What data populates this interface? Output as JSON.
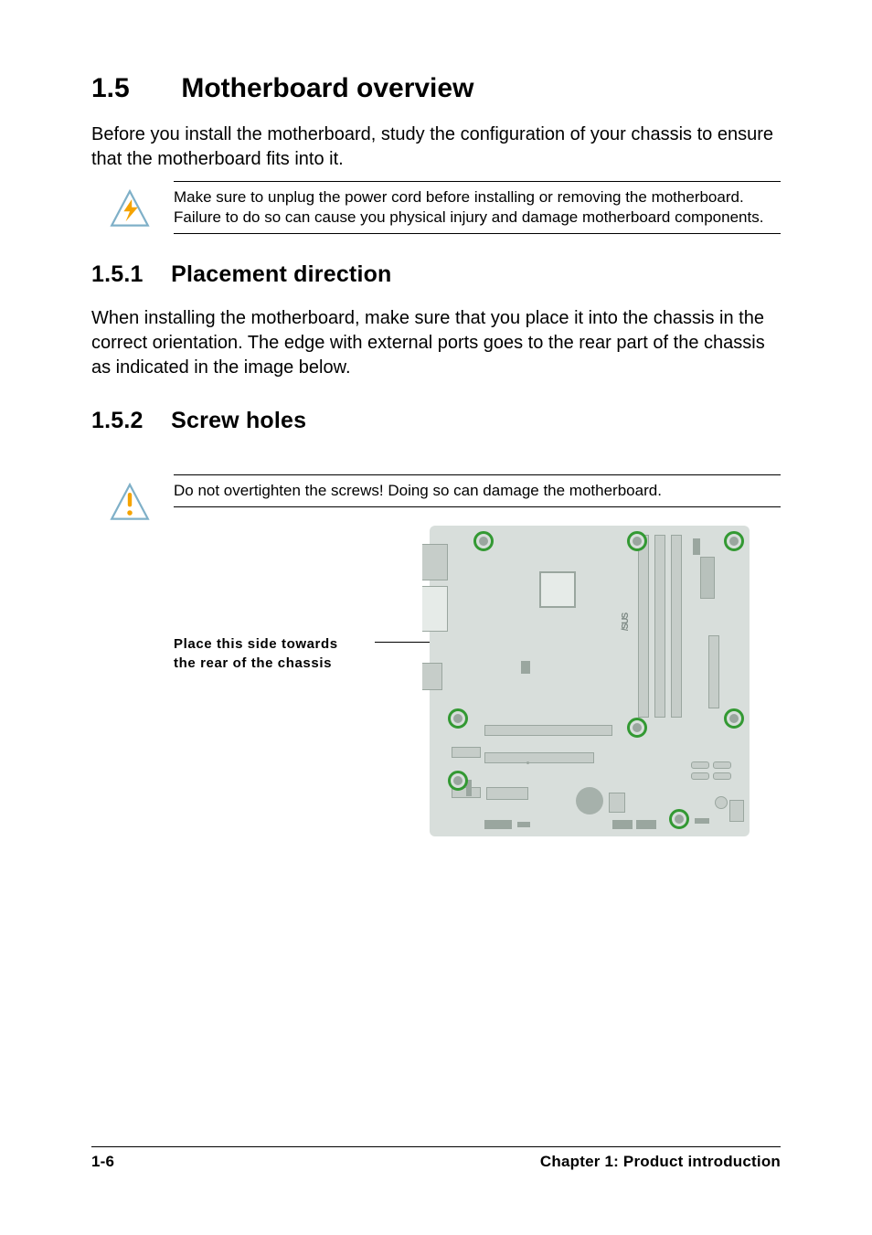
{
  "section": {
    "number": "1.5",
    "title": "Motherboard overview",
    "intro": "Before you install the motherboard, study the configuration of your chassis to ensure that the motherboard fits into it."
  },
  "warning1": {
    "text": "Make sure to unplug the power cord before installing or removing the motherboard. Failure to do so can cause you physical injury and damage motherboard components."
  },
  "sub1": {
    "number": "1.5.1",
    "title": "Placement direction",
    "body": "When installing the motherboard, make sure that you place it into the chassis in the correct orientation. The edge with external ports goes to the rear part of the chassis as indicated in the image below."
  },
  "sub2": {
    "number": "1.5.2",
    "title": "Screw holes"
  },
  "warning2": {
    "text": "Do not overtighten the screws! Doing so can damage the motherboard."
  },
  "diagram": {
    "label_line1": "Place this side towards",
    "label_line2": "the rear of the chassis",
    "brand": "/SUS"
  },
  "footer": {
    "page": "1-6",
    "chapter": "Chapter 1: Product introduction"
  }
}
